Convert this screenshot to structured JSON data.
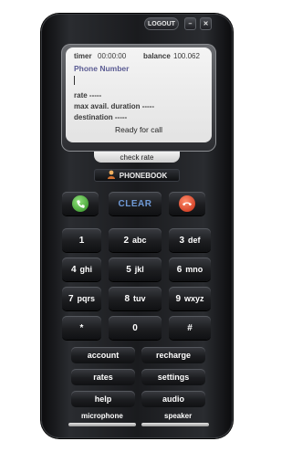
{
  "window": {
    "logout_label": "LOGOUT",
    "minimize_label": "–",
    "close_label": "✕"
  },
  "screen": {
    "timer_label": "timer",
    "timer_value": "00:00:00",
    "balance_label": "balance",
    "balance_value": "100.062",
    "phone_number_label": "Phone Number",
    "rate_label": "rate -----",
    "max_duration_label": "max avail. duration -----",
    "destination_label": "destination -----",
    "status_text": "Ready for call"
  },
  "check_rate_label": "check rate",
  "phonebook_label": "PHONEBOOK",
  "call_controls": {
    "clear_label": "CLEAR",
    "call_icon": "phone-call-icon",
    "hangup_icon": "phone-hangup-icon"
  },
  "keypad": [
    {
      "digit": "1",
      "letters": ""
    },
    {
      "digit": "2",
      "letters": "abc"
    },
    {
      "digit": "3",
      "letters": "def"
    },
    {
      "digit": "4",
      "letters": "ghi"
    },
    {
      "digit": "5",
      "letters": "jkl"
    },
    {
      "digit": "6",
      "letters": "mno"
    },
    {
      "digit": "7",
      "letters": "pqrs"
    },
    {
      "digit": "8",
      "letters": "tuv"
    },
    {
      "digit": "9",
      "letters": "wxyz"
    },
    {
      "digit": "*",
      "letters": ""
    },
    {
      "digit": "0",
      "letters": ""
    },
    {
      "digit": "#",
      "letters": ""
    }
  ],
  "function_keys": {
    "account": "account",
    "recharge": "recharge",
    "rates": "rates",
    "settings": "settings",
    "help": "help",
    "audio": "audio"
  },
  "audio_sliders": {
    "microphone_label": "microphone",
    "speaker_label": "speaker"
  }
}
